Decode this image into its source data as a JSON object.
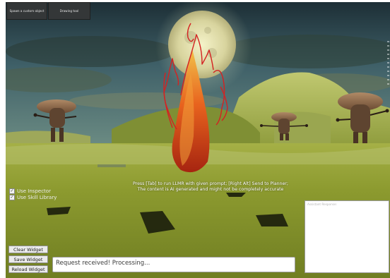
{
  "toolbar": {
    "spawn_label": "Spawn a custom object",
    "draw_label": "Drawing tool"
  },
  "hint": {
    "line1": "Press [Tab] to run LLMR with given prompt; [Right Alt] Send to Planner;",
    "line2": "The content is AI generated and might not be completely accurate"
  },
  "options": {
    "inspector_label": "Use Inspector",
    "skill_label": "Use Skill Library"
  },
  "widget_buttons": {
    "clear": "Clear Widget",
    "save": "Save Widget",
    "reload": "Reload Widget"
  },
  "status": {
    "text": "Request received! Processing..."
  },
  "assistant": {
    "placeholder": "Assistant Response:"
  },
  "colors": {
    "ground": "#8a9a2e",
    "sky": "#2e4450",
    "flame": "#e8501a",
    "sketch": "#d42222"
  }
}
